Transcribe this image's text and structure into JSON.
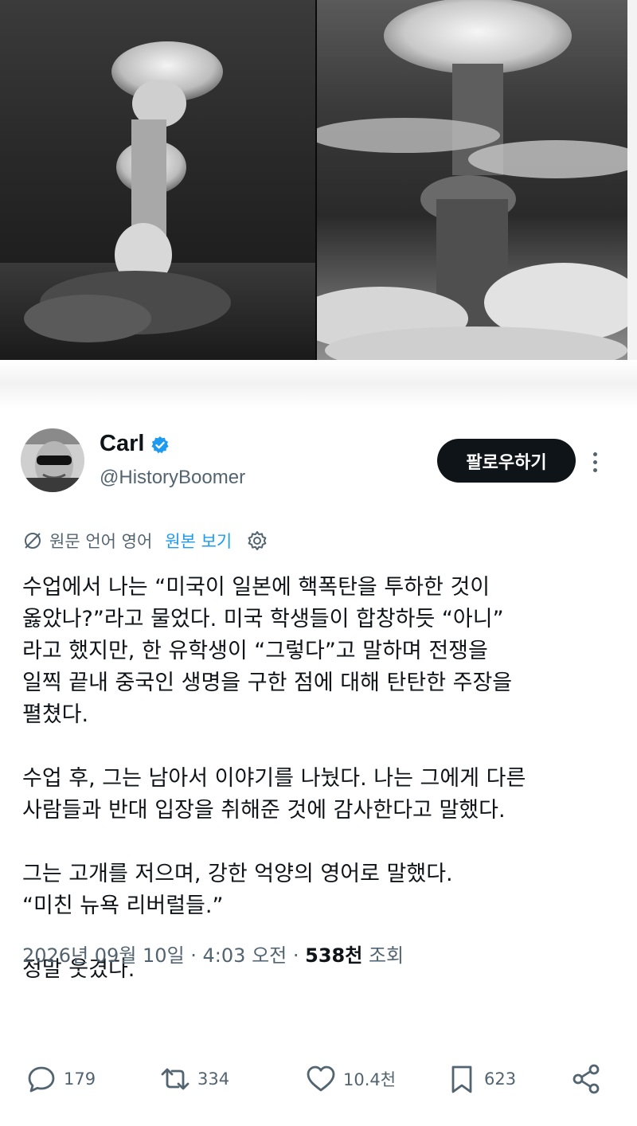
{
  "media": {
    "alt_badge_icon": "alt-text-bubble-icon"
  },
  "author": {
    "display_name": "Carl",
    "handle": "@HistoryBoomer",
    "verified_icon": "verified-badge-icon",
    "verified_color": "#1d9bf0"
  },
  "follow_button": {
    "label": "팔로우하기"
  },
  "more_icon": "more-dots-icon",
  "translation": {
    "icon": "translate-icon",
    "source_text": "원문 언어 영어",
    "view_original": "원본 보기",
    "settings_icon": "gear-icon"
  },
  "tweet": {
    "lines": [
      "수업에서 나는 “미국이 일본에 핵폭탄을 투하한 것이",
      "옳았나?”라고 물었다. 미국 학생들이 합창하듯 “아니”",
      "라고 했지만, 한 유학생이 “그렇다”고 말하며 전쟁을",
      "일찍 끝내 중국인 생명을 구한 점에 대해 탄탄한 주장을",
      "펼쳤다.",
      "",
      "수업 후, 그는 남아서 이야기를 나눴다. 나는 그에게 다른",
      "사람들과 반대 입장을 취해준 것에 감사한다고 말했다.",
      "",
      "그는 고개를 저으며, 강한 억양의 영어로 말했다.",
      "“미친 뉴욕 리버럴들.”",
      "",
      "정말 웃겼다."
    ]
  },
  "meta": {
    "datetime": "2026년 09월 10일 · 4:03 오전 · ",
    "views_count": "538천",
    "views_label": " 조회"
  },
  "actions": {
    "reply_count": "179",
    "repost_count": "334",
    "like_count": "10.4천",
    "bookmark_count": "623"
  }
}
